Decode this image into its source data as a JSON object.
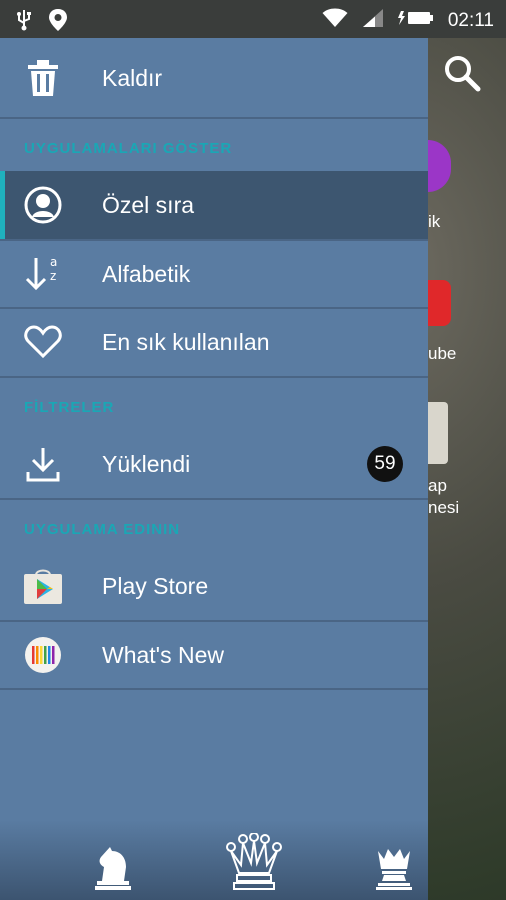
{
  "status_bar": {
    "time": "02:11"
  },
  "drawer": {
    "remove": {
      "label": "Kaldır"
    },
    "section_show": "UYGULAMALARI GÖSTER",
    "sort_items": [
      {
        "label": "Özel sıra",
        "icon": "person-circle-icon",
        "selected": true
      },
      {
        "label": "Alfabetik",
        "icon": "sort-alpha-icon",
        "selected": false
      },
      {
        "label": "En sık kullanılan",
        "icon": "heart-icon",
        "selected": false
      }
    ],
    "section_filters": "FİLTRELER",
    "filter_items": [
      {
        "label": "Yüklendi",
        "icon": "download-icon",
        "badge": "59"
      }
    ],
    "section_find": "UYGULAMA EDININ",
    "find_items": [
      {
        "label": "Play Store",
        "icon": "play-store-icon"
      },
      {
        "label": "What's New",
        "icon": "whats-new-icon"
      }
    ]
  },
  "home_peek": {
    "labels": [
      "ik",
      "ube",
      "ap",
      "nesi"
    ]
  },
  "colors": {
    "drawer_bg": "#5a7ca2",
    "selected_bg": "#3d5670",
    "accent": "#1fb1be",
    "section_text": "#1aa7b5"
  }
}
